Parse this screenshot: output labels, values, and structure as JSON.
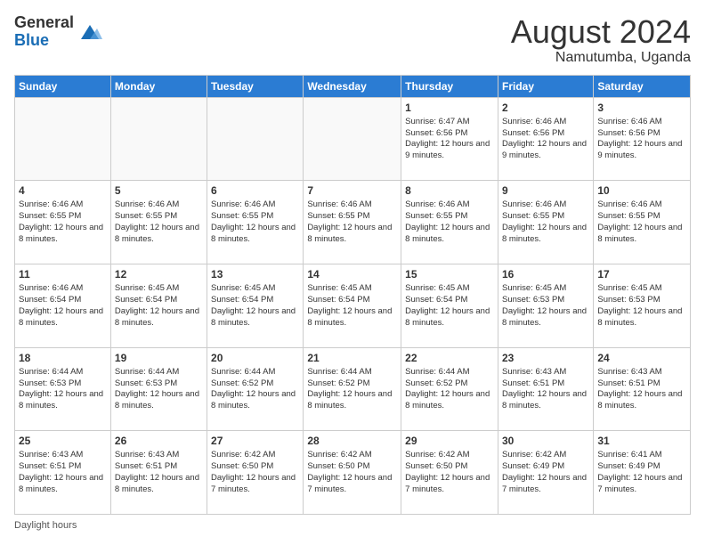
{
  "logo": {
    "general": "General",
    "blue": "Blue"
  },
  "title": {
    "month_year": "August 2024",
    "location": "Namutumba, Uganda"
  },
  "days_of_week": [
    "Sunday",
    "Monday",
    "Tuesday",
    "Wednesday",
    "Thursday",
    "Friday",
    "Saturday"
  ],
  "footer": {
    "daylight_label": "Daylight hours"
  },
  "weeks": [
    [
      {
        "day": "",
        "info": ""
      },
      {
        "day": "",
        "info": ""
      },
      {
        "day": "",
        "info": ""
      },
      {
        "day": "",
        "info": ""
      },
      {
        "day": "1",
        "info": "Sunrise: 6:47 AM\nSunset: 6:56 PM\nDaylight: 12 hours and 9 minutes."
      },
      {
        "day": "2",
        "info": "Sunrise: 6:46 AM\nSunset: 6:56 PM\nDaylight: 12 hours and 9 minutes."
      },
      {
        "day": "3",
        "info": "Sunrise: 6:46 AM\nSunset: 6:56 PM\nDaylight: 12 hours and 9 minutes."
      }
    ],
    [
      {
        "day": "4",
        "info": "Sunrise: 6:46 AM\nSunset: 6:55 PM\nDaylight: 12 hours and 8 minutes."
      },
      {
        "day": "5",
        "info": "Sunrise: 6:46 AM\nSunset: 6:55 PM\nDaylight: 12 hours and 8 minutes."
      },
      {
        "day": "6",
        "info": "Sunrise: 6:46 AM\nSunset: 6:55 PM\nDaylight: 12 hours and 8 minutes."
      },
      {
        "day": "7",
        "info": "Sunrise: 6:46 AM\nSunset: 6:55 PM\nDaylight: 12 hours and 8 minutes."
      },
      {
        "day": "8",
        "info": "Sunrise: 6:46 AM\nSunset: 6:55 PM\nDaylight: 12 hours and 8 minutes."
      },
      {
        "day": "9",
        "info": "Sunrise: 6:46 AM\nSunset: 6:55 PM\nDaylight: 12 hours and 8 minutes."
      },
      {
        "day": "10",
        "info": "Sunrise: 6:46 AM\nSunset: 6:55 PM\nDaylight: 12 hours and 8 minutes."
      }
    ],
    [
      {
        "day": "11",
        "info": "Sunrise: 6:46 AM\nSunset: 6:54 PM\nDaylight: 12 hours and 8 minutes."
      },
      {
        "day": "12",
        "info": "Sunrise: 6:45 AM\nSunset: 6:54 PM\nDaylight: 12 hours and 8 minutes."
      },
      {
        "day": "13",
        "info": "Sunrise: 6:45 AM\nSunset: 6:54 PM\nDaylight: 12 hours and 8 minutes."
      },
      {
        "day": "14",
        "info": "Sunrise: 6:45 AM\nSunset: 6:54 PM\nDaylight: 12 hours and 8 minutes."
      },
      {
        "day": "15",
        "info": "Sunrise: 6:45 AM\nSunset: 6:54 PM\nDaylight: 12 hours and 8 minutes."
      },
      {
        "day": "16",
        "info": "Sunrise: 6:45 AM\nSunset: 6:53 PM\nDaylight: 12 hours and 8 minutes."
      },
      {
        "day": "17",
        "info": "Sunrise: 6:45 AM\nSunset: 6:53 PM\nDaylight: 12 hours and 8 minutes."
      }
    ],
    [
      {
        "day": "18",
        "info": "Sunrise: 6:44 AM\nSunset: 6:53 PM\nDaylight: 12 hours and 8 minutes."
      },
      {
        "day": "19",
        "info": "Sunrise: 6:44 AM\nSunset: 6:53 PM\nDaylight: 12 hours and 8 minutes."
      },
      {
        "day": "20",
        "info": "Sunrise: 6:44 AM\nSunset: 6:52 PM\nDaylight: 12 hours and 8 minutes."
      },
      {
        "day": "21",
        "info": "Sunrise: 6:44 AM\nSunset: 6:52 PM\nDaylight: 12 hours and 8 minutes."
      },
      {
        "day": "22",
        "info": "Sunrise: 6:44 AM\nSunset: 6:52 PM\nDaylight: 12 hours and 8 minutes."
      },
      {
        "day": "23",
        "info": "Sunrise: 6:43 AM\nSunset: 6:51 PM\nDaylight: 12 hours and 8 minutes."
      },
      {
        "day": "24",
        "info": "Sunrise: 6:43 AM\nSunset: 6:51 PM\nDaylight: 12 hours and 8 minutes."
      }
    ],
    [
      {
        "day": "25",
        "info": "Sunrise: 6:43 AM\nSunset: 6:51 PM\nDaylight: 12 hours and 8 minutes."
      },
      {
        "day": "26",
        "info": "Sunrise: 6:43 AM\nSunset: 6:51 PM\nDaylight: 12 hours and 8 minutes."
      },
      {
        "day": "27",
        "info": "Sunrise: 6:42 AM\nSunset: 6:50 PM\nDaylight: 12 hours and 7 minutes."
      },
      {
        "day": "28",
        "info": "Sunrise: 6:42 AM\nSunset: 6:50 PM\nDaylight: 12 hours and 7 minutes."
      },
      {
        "day": "29",
        "info": "Sunrise: 6:42 AM\nSunset: 6:50 PM\nDaylight: 12 hours and 7 minutes."
      },
      {
        "day": "30",
        "info": "Sunrise: 6:42 AM\nSunset: 6:49 PM\nDaylight: 12 hours and 7 minutes."
      },
      {
        "day": "31",
        "info": "Sunrise: 6:41 AM\nSunset: 6:49 PM\nDaylight: 12 hours and 7 minutes."
      }
    ]
  ]
}
